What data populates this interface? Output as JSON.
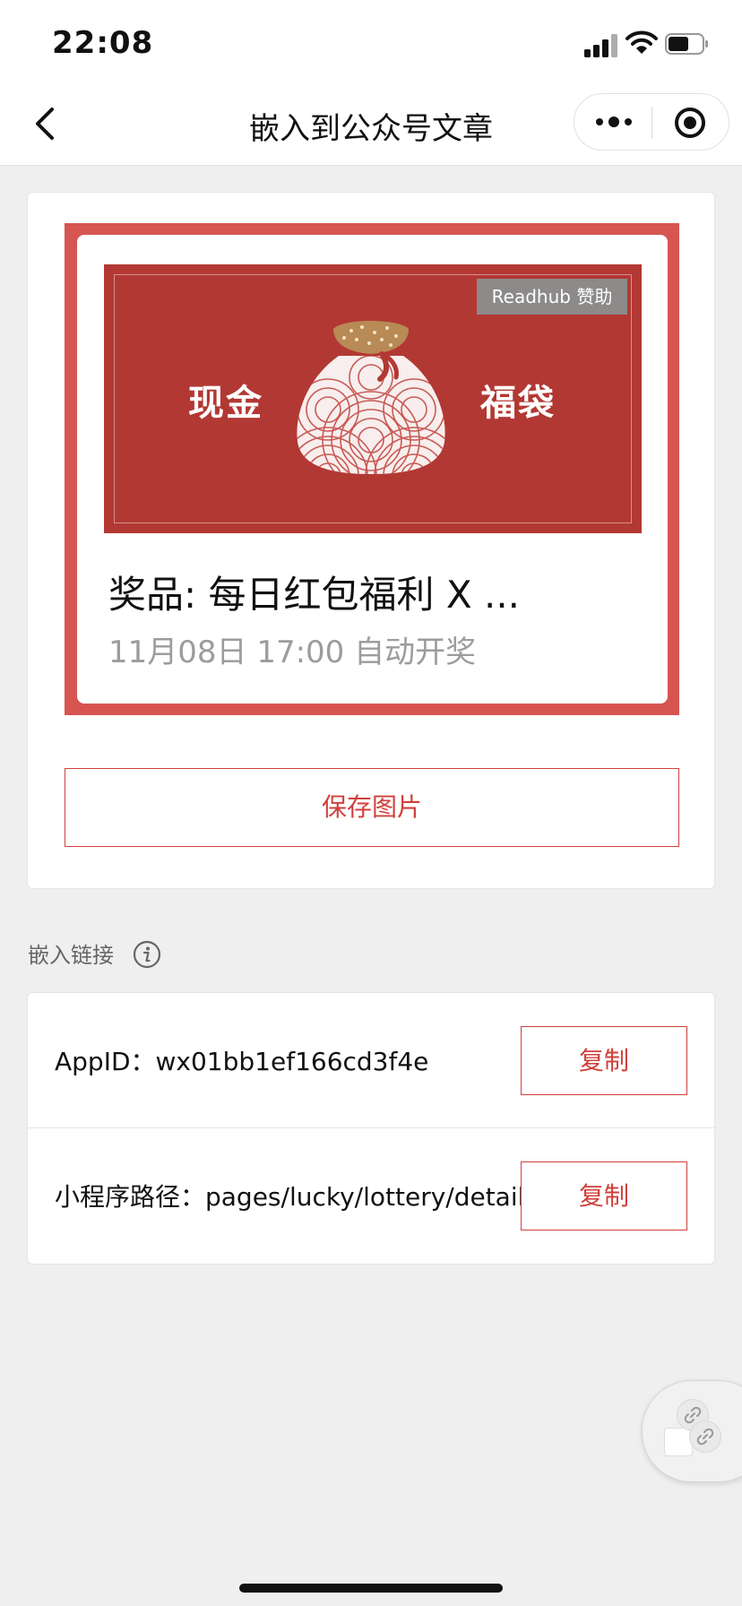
{
  "status_bar": {
    "time": "22:08",
    "icons": [
      "signal-icon",
      "wifi-icon",
      "battery-icon"
    ]
  },
  "nav": {
    "title": "嵌入到公众号文章",
    "back_icon": "chevron-left-icon",
    "menu_icons": [
      "more-dots-icon",
      "target-circle-icon"
    ]
  },
  "poster": {
    "banner_left": "现金",
    "banner_right": "福袋",
    "sponsor": "Readhub 赞助",
    "prize": "奖品: 每日红包福利 X ...",
    "draw_time": "11月08日 17:00 自动开奖"
  },
  "save_button": "保存图片",
  "embed": {
    "title": "嵌入链接",
    "info_icon": "info-icon",
    "rows": [
      {
        "label": "AppID：wx01bb1ef166cd3f4e",
        "button": "复制"
      },
      {
        "label": "小程序路径：pages/lucky/lottery/detail",
        "button": "复制"
      }
    ]
  },
  "colors": {
    "accent_red": "#d0403b",
    "frame_red": "#d75551",
    "banner_red": "#b23833",
    "page_bg": "#efefef"
  }
}
